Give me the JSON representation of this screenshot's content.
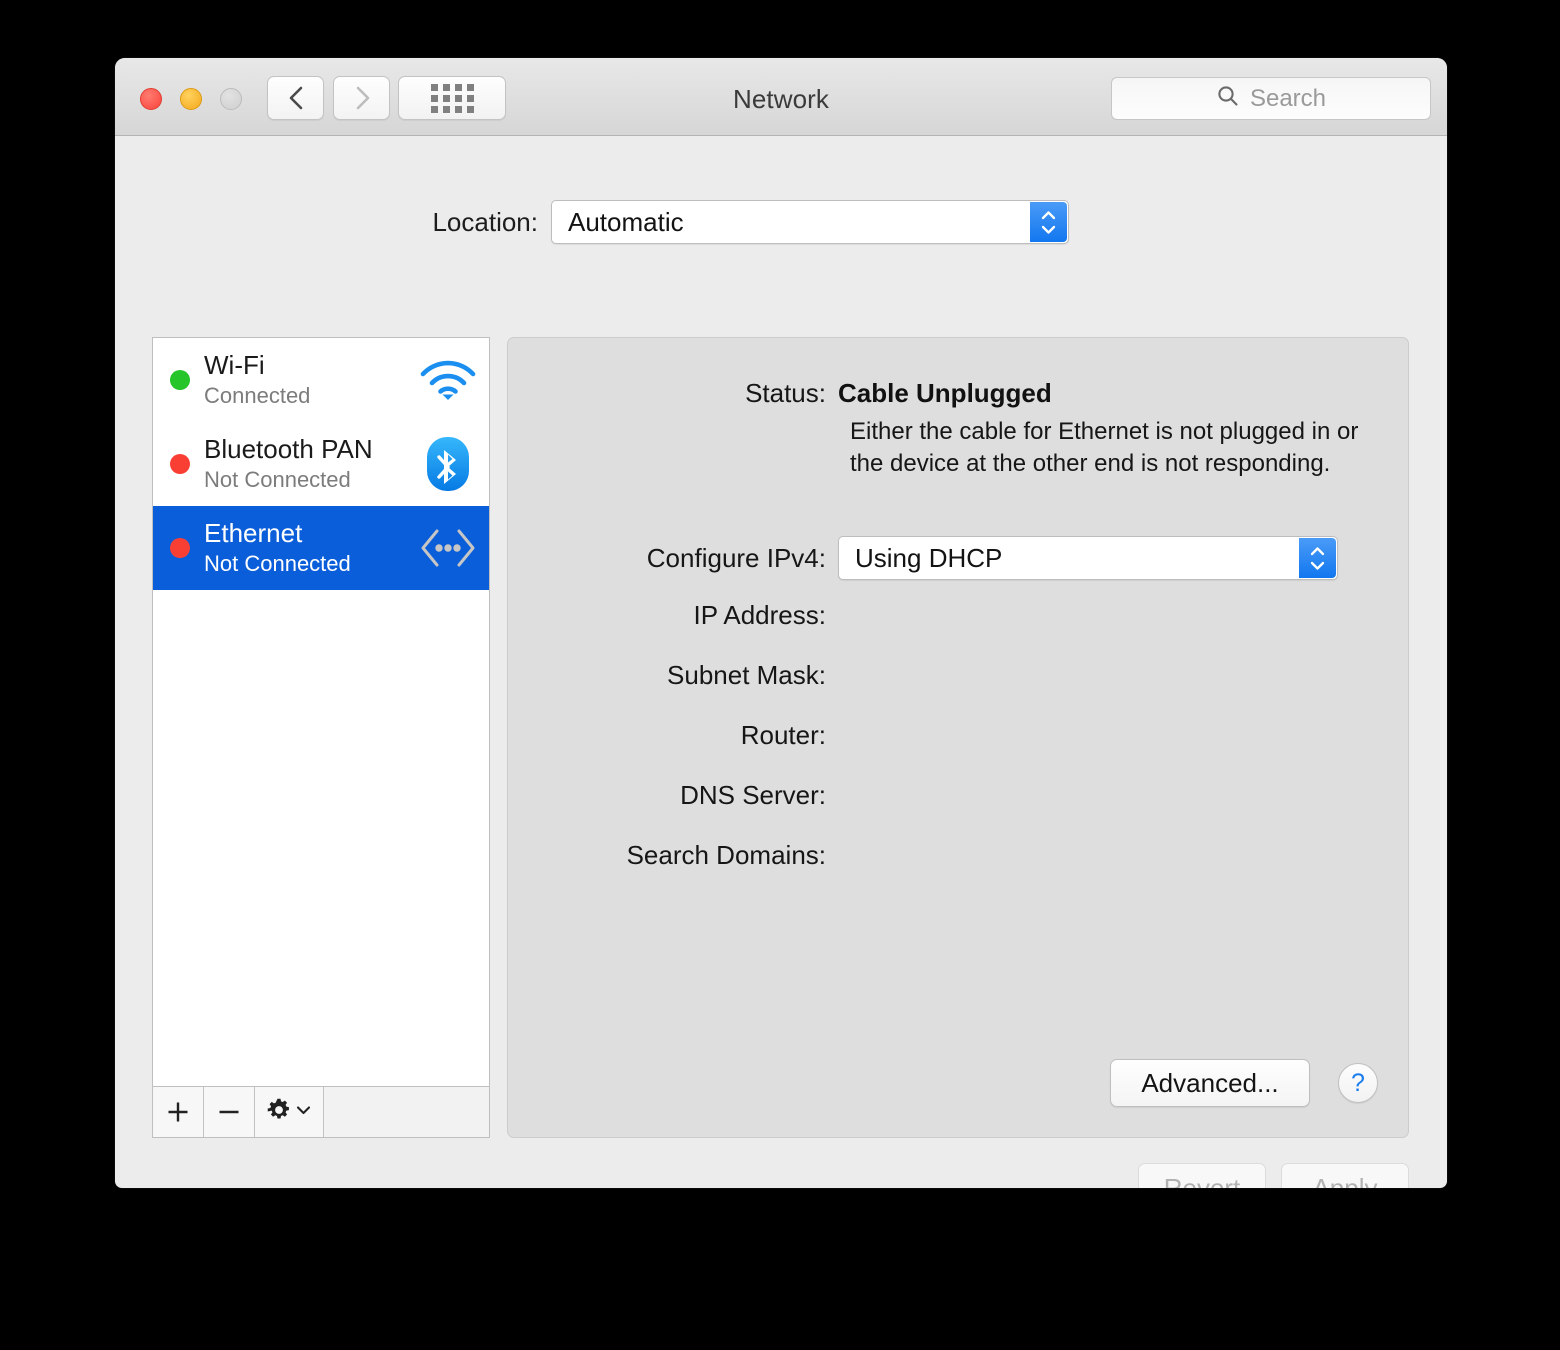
{
  "window": {
    "title": "Network",
    "traffic_lights": [
      {
        "name": "close",
        "color": "#f9443a"
      },
      {
        "name": "minimize",
        "color": "#f5a81c"
      },
      {
        "name": "zoom",
        "color": "#cfcfcf"
      }
    ]
  },
  "toolbar": {
    "back_icon": "chevron-left-icon",
    "forward_icon": "chevron-right-icon",
    "show_all_icon": "grid-icon",
    "search_placeholder": "Search",
    "search_value": "",
    "search_icon": "search-icon"
  },
  "location": {
    "label": "Location:",
    "value": "Automatic",
    "options": [
      "Automatic"
    ]
  },
  "sidebar": {
    "services": [
      {
        "name": "Wi-Fi",
        "status": "Connected",
        "dot_color": "#26c52a",
        "icon": "wifi-icon",
        "selected": false
      },
      {
        "name": "Bluetooth PAN",
        "status": "Not Connected",
        "dot_color": "#f93f34",
        "icon": "bluetooth-icon",
        "selected": false
      },
      {
        "name": "Ethernet",
        "status": "Not Connected",
        "dot_color": "#f93f34",
        "icon": "ethernet-icon",
        "selected": true
      }
    ],
    "toolbar": {
      "add_label": "+",
      "remove_label": "−",
      "action_icon": "gear-icon",
      "action_chevron_icon": "chevron-down-icon"
    }
  },
  "detail": {
    "status_label": "Status:",
    "status_value": "Cable Unplugged",
    "status_description": "Either the cable for Ethernet is not plugged in or the device at the other end is not responding.",
    "configure_label": "Configure IPv4:",
    "configure_value": "Using DHCP",
    "configure_options": [
      "Using DHCP"
    ],
    "fields": [
      {
        "label": "IP Address:",
        "value": ""
      },
      {
        "label": "Subnet Mask:",
        "value": ""
      },
      {
        "label": "Router:",
        "value": ""
      },
      {
        "label": "DNS Server:",
        "value": ""
      },
      {
        "label": "Search Domains:",
        "value": ""
      }
    ],
    "advanced_label": "Advanced...",
    "help_label": "?"
  },
  "footer": {
    "revert_label": "Revert",
    "apply_label": "Apply"
  },
  "colors": {
    "accent_blue": "#0b5ed9",
    "stepper_blue": "#1277ef",
    "window_bg": "#ececec",
    "pane_bg": "#dedede"
  }
}
